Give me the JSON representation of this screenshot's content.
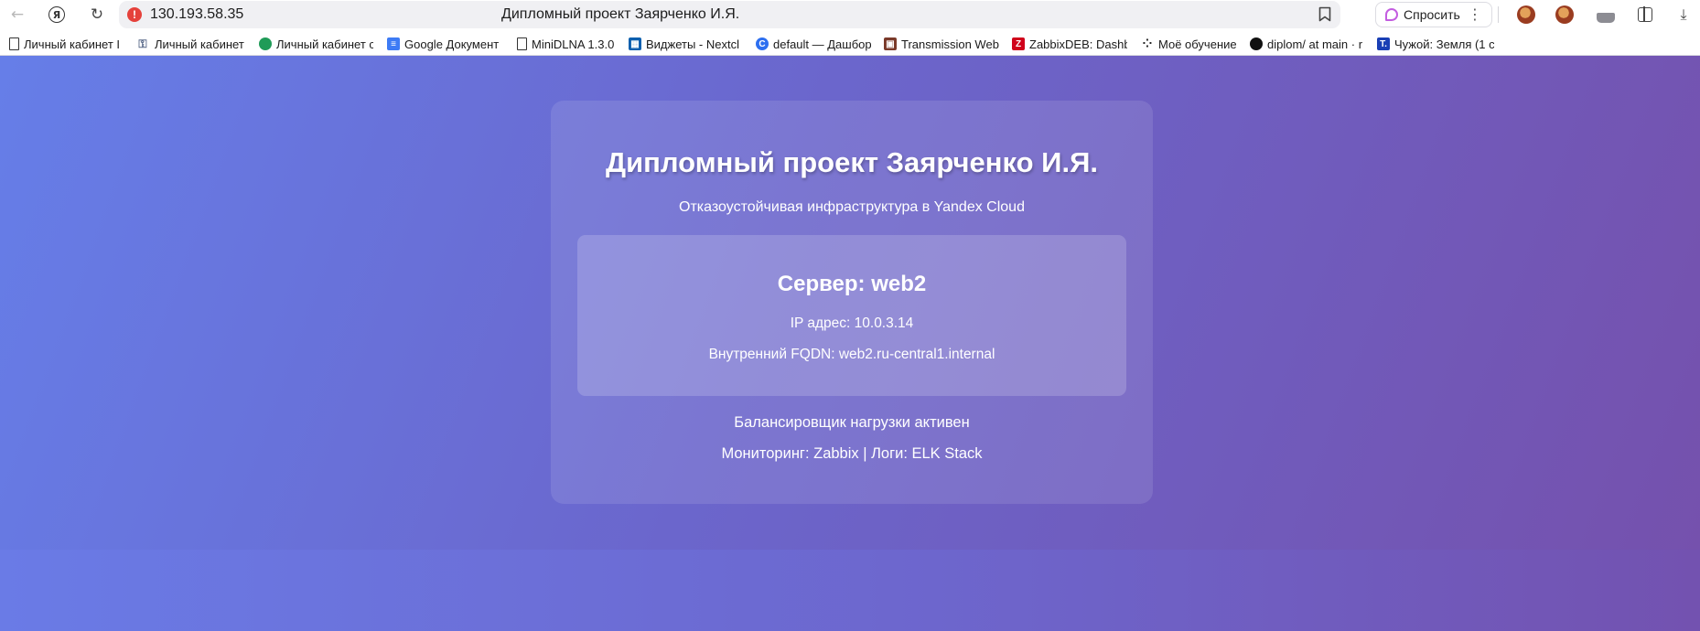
{
  "browser": {
    "url": "130.193.58.35",
    "tab_title": "Дипломный проект Заярченко И.Я.",
    "ask_button": "Спросить",
    "nav": {
      "back_icon": "←",
      "yandex_icon": "Я",
      "reload_icon": "↻",
      "menu_icon": "⋮",
      "download_icon": "⤓"
    }
  },
  "bookmarks": [
    {
      "label": "Личный кабинет I",
      "icon": "doc-icon"
    },
    {
      "label": "Личный кабинет",
      "icon": "key-icon"
    },
    {
      "label": "Личный кабинет с",
      "icon": "green-circle-icon"
    },
    {
      "label": "Google Документ",
      "icon": "google-docs-icon"
    },
    {
      "label": "MiniDLNA 1.3.0",
      "icon": "doc-icon"
    },
    {
      "label": "Виджеты - Nextcl",
      "icon": "nextcloud-icon"
    },
    {
      "label": "default — Дашбор",
      "icon": "c-icon"
    },
    {
      "label": "Transmission Web",
      "icon": "transmission-icon"
    },
    {
      "label": "ZabbixDEB: Dashb",
      "icon": "zabbix-icon"
    },
    {
      "label": "Моё обучение",
      "icon": "dots-icon"
    },
    {
      "label": "diplom/ at main · r",
      "icon": "github-icon"
    },
    {
      "label": "Чужой: Земля (1 с",
      "icon": "t-icon"
    }
  ],
  "page": {
    "title": "Дипломный проект Заярченко И.Я.",
    "subtitle": "Отказоустойчивая инфраструктура в Yandex Cloud",
    "server": {
      "name": "Сервер: web2",
      "ip": "IP адрес: 10.0.3.14",
      "fqdn": "Внутренний FQDN: web2.ru-central1.internal"
    },
    "balancer": "Балансировщик нагрузки активен",
    "monitoring": "Мониторинг: Zabbix | Логи: ELK Stack"
  }
}
